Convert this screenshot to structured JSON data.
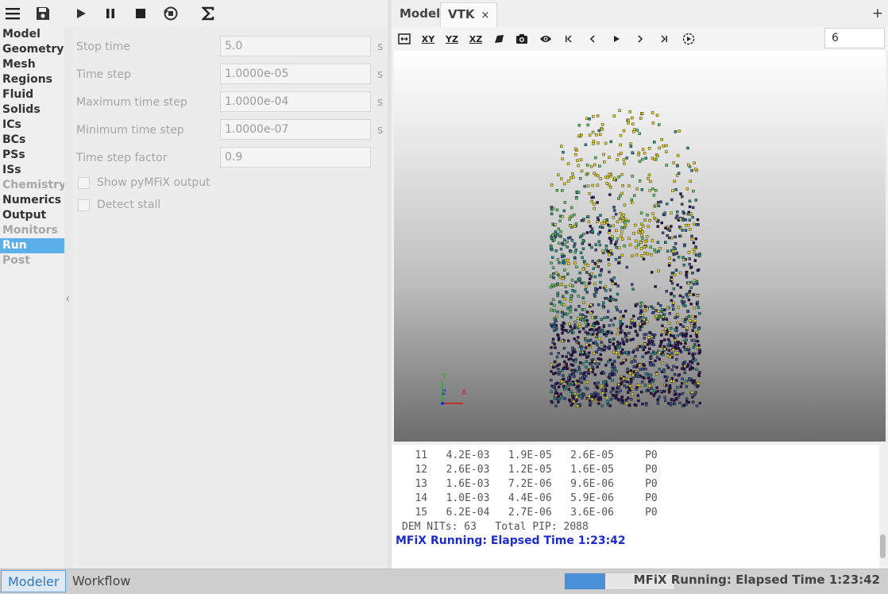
{
  "toolbar": {
    "icons": [
      "menu-icon",
      "save-icon",
      "run-icon",
      "pause-icon",
      "stop-icon",
      "reset-icon",
      "sigma-icon"
    ]
  },
  "nav": {
    "items": [
      {
        "label": "Model",
        "state": "normal"
      },
      {
        "label": "Geometry",
        "state": "normal"
      },
      {
        "label": "Mesh",
        "state": "normal"
      },
      {
        "label": "Regions",
        "state": "normal"
      },
      {
        "label": "Fluid",
        "state": "normal"
      },
      {
        "label": "Solids",
        "state": "normal"
      },
      {
        "label": "ICs",
        "state": "normal"
      },
      {
        "label": "BCs",
        "state": "normal"
      },
      {
        "label": "PSs",
        "state": "normal"
      },
      {
        "label": "ISs",
        "state": "normal"
      },
      {
        "label": "Chemistry",
        "state": "disabled"
      },
      {
        "label": "Numerics",
        "state": "normal"
      },
      {
        "label": "Output",
        "state": "normal"
      },
      {
        "label": "Monitors",
        "state": "disabled"
      },
      {
        "label": "Run",
        "state": "active"
      },
      {
        "label": "Post",
        "state": "disabled"
      }
    ]
  },
  "run_panel": {
    "fields": [
      {
        "label": "Stop time",
        "value": "5.0",
        "unit": "s"
      },
      {
        "label": "Time step",
        "value": "1.0000e-05",
        "unit": "s"
      },
      {
        "label": "Maximum time step",
        "value": "1.0000e-04",
        "unit": "s"
      },
      {
        "label": "Minimum time step",
        "value": "1.0000e-07",
        "unit": "s"
      },
      {
        "label": "Time step factor",
        "value": "0.9",
        "unit": ""
      }
    ],
    "checkboxes": [
      {
        "label": "Show pyMFiX output",
        "checked": false
      },
      {
        "label": "Detect stall",
        "checked": false
      }
    ]
  },
  "tabs": {
    "model": "Model",
    "vtk": "VTK",
    "close": "×",
    "add": "+"
  },
  "vtk_toolbar": {
    "labels": [
      "XY",
      "YZ",
      "XZ"
    ],
    "frame": "6"
  },
  "axes": {
    "y": "Y",
    "z": "Z",
    "x": "X"
  },
  "console": {
    "lines": [
      "   11   4.2E-03   1.9E-05   2.6E-05     P0",
      "   12   2.6E-03   1.2E-05   1.6E-05     P0",
      "   13   1.6E-03   7.2E-06   9.6E-06     P0",
      "   14   1.0E-03   4.4E-06   5.9E-06     P0",
      "   15   6.2E-04   2.7E-06   3.6E-06     P0",
      "DEM NITs: 63   Total PIP: 2088"
    ],
    "status": "MFiX Running: Elapsed Time 1:23:42",
    "status_color": "#1b2dce"
  },
  "bottom": {
    "modeler": "Modeler",
    "workflow": "Workflow",
    "progress": 0.37,
    "status": "MFiX Running: Elapsed Time 1:23:42"
  },
  "colors": {
    "accent": "#5bb0ec",
    "particles": [
      "#2d1152",
      "#3b4f8a",
      "#21918c",
      "#5ec962",
      "#e6d51a"
    ]
  }
}
